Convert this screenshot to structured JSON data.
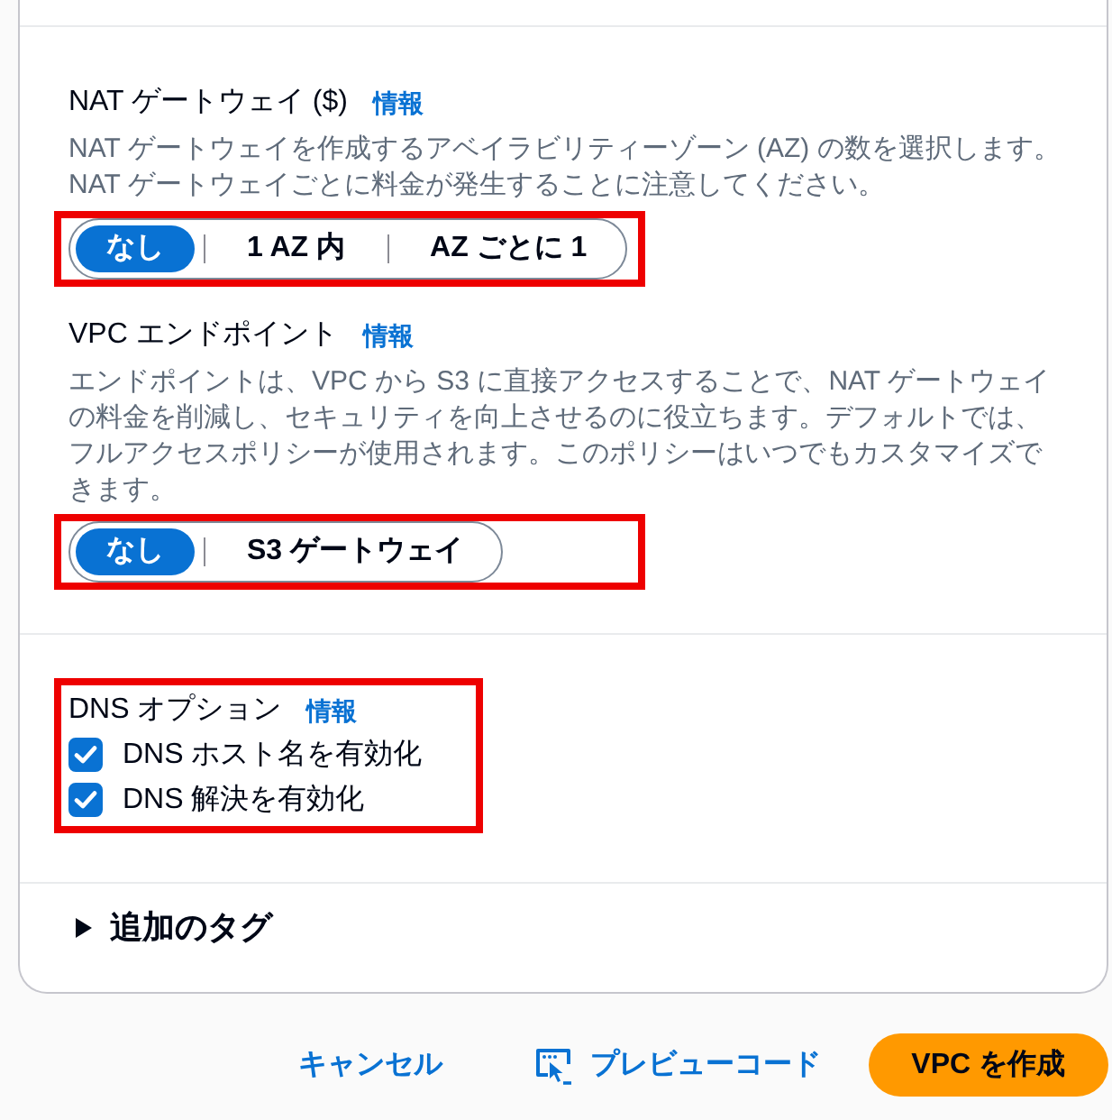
{
  "nat_gateway": {
    "title": "NAT ゲートウェイ ($)",
    "info_link": "情報",
    "description": "NAT ゲートウェイを作成するアベイラビリティーゾーン (AZ) の数を選択します。NAT ゲートウェイごとに料金が発生することに注意してください。",
    "highlighted": true,
    "options": [
      {
        "label": "なし",
        "selected": true
      },
      {
        "label": "1 AZ 内",
        "selected": false
      },
      {
        "label": "AZ ごとに 1",
        "selected": false
      }
    ]
  },
  "vpc_endpoints": {
    "title": "VPC エンドポイント",
    "info_link": "情報",
    "description": "エンドポイントは、VPC から S3 に直接アクセスすることで、NAT ゲートウェイの料金を削減し、セキュリティを向上させるのに役立ちます。デフォルトでは、フルアクセスポリシーが使用されます。このポリシーはいつでもカスタマイズできます。",
    "highlighted": true,
    "options": [
      {
        "label": "なし",
        "selected": true
      },
      {
        "label": "S3 ゲートウェイ",
        "selected": false
      }
    ]
  },
  "dns_options": {
    "title": "DNS オプション",
    "info_link": "情報",
    "highlighted": true,
    "checkboxes": [
      {
        "label": "DNS ホスト名を有効化",
        "checked": true
      },
      {
        "label": "DNS 解決を有効化",
        "checked": true
      }
    ]
  },
  "additional_tags": {
    "label": "追加のタグ",
    "expanded": false
  },
  "footer": {
    "cancel": "キャンセル",
    "preview_code": "プレビューコード",
    "create": "VPC を作成"
  }
}
